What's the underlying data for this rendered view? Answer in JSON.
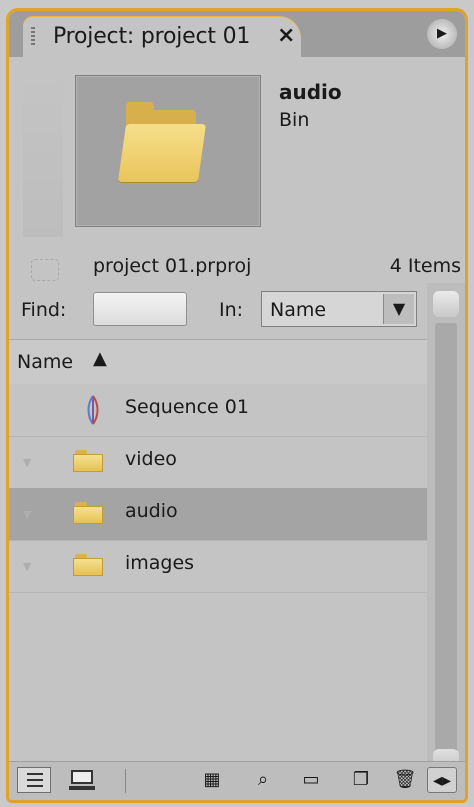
{
  "panel": {
    "tab_title": "Project: project 01",
    "close_glyph": "×",
    "menu_glyph": "▶"
  },
  "preview": {
    "clip_name": "audio",
    "clip_type": "Bin",
    "thumbnail_icon": "folder-icon"
  },
  "info": {
    "project_file": "project 01.prproj",
    "item_count": "4 Items"
  },
  "find": {
    "label": "Find:",
    "value": "",
    "placeholder": "",
    "in_label": "In:",
    "in_value": "Name"
  },
  "list": {
    "column_header": "Name",
    "sort_glyph": "▲",
    "rows": [
      {
        "name": "Sequence 01",
        "icon": "sequence-icon",
        "selected": false
      },
      {
        "name": "video",
        "icon": "folder-icon",
        "selected": false
      },
      {
        "name": "audio",
        "icon": "folder-icon",
        "selected": true
      },
      {
        "name": "images",
        "icon": "folder-icon",
        "selected": false
      }
    ]
  },
  "toolbar": {
    "buttons": [
      "list-view-icon",
      "icon-view-icon",
      "automate-to-sequence-icon",
      "find-icon",
      "new-bin-icon",
      "new-item-icon",
      "clear-icon",
      "resize-icon"
    ]
  },
  "colors": {
    "accent_border": "#e0a32a",
    "panel_bg": "#c4c4c4",
    "selected_row": "#a4a4a4"
  }
}
